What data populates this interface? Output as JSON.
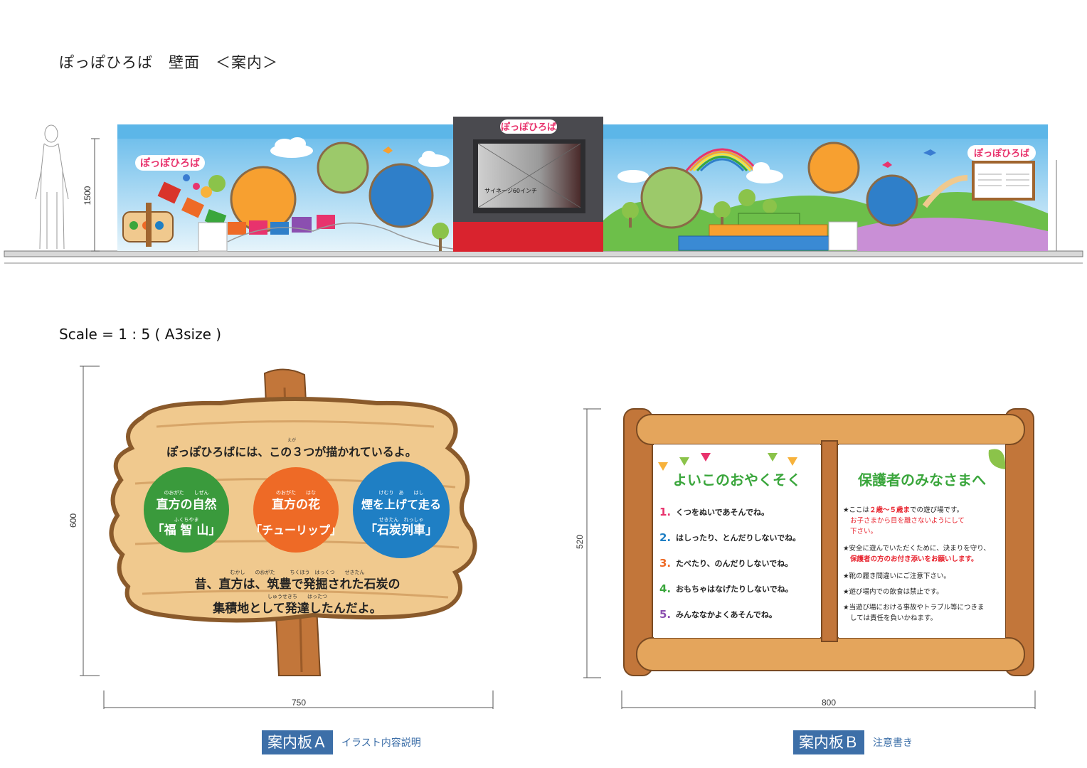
{
  "page_title": "ぽっぽひろば　壁面　＜案内＞",
  "scale": "Scale = 1 : 5 ( A3size )",
  "elevation": {
    "height_dim": "1500",
    "logo_text": "ぽっぽひろば",
    "signage_label": "サイネージ60インチ"
  },
  "signA": {
    "height_dim": "600",
    "width_dim": "750",
    "heading": "ぽっぽひろばには、この３つが描かれているよ。",
    "heading_ruby": "えが",
    "circles": [
      {
        "ruby1": "のおがた　　しぜん",
        "line1": "直方の自然",
        "ruby2": "ふくちやま",
        "line2": "「福 智 山」",
        "color": "#3a9a3c"
      },
      {
        "ruby1": "のおがた　　はな",
        "line1": "直方の花",
        "ruby2": "",
        "line2": "「チューリップ」",
        "color": "#ee6a26"
      },
      {
        "ruby1": "けむり　あ　　はし",
        "line1": "煙を上げて走る",
        "ruby2": "せきたん　れっしゃ",
        "line2": "「石炭列車」",
        "color": "#1f7fc4"
      }
    ],
    "bottom_ruby1": "むかし　　のおがた　　　ちくほう　はっくつ　　せきたん",
    "bottom_line1": "昔、直方は、筑豊で発掘された石炭の",
    "bottom_ruby2": "しゅうせきち　　はったつ",
    "bottom_line2": "集積地として発達したんだよ。",
    "caption": "案内板Ａ",
    "caption_sub": "イラスト内容説明"
  },
  "signB": {
    "height_dim": "520",
    "width_dim": "800",
    "left_title": "よいこのおやくそく",
    "rules": [
      {
        "num": "1.",
        "text": "くつをぬいであそんでね。",
        "color": "#e8336d"
      },
      {
        "num": "2.",
        "text": "はしったり、とんだりしないでね。",
        "color": "#1f7fc4"
      },
      {
        "num": "3.",
        "text": "たべたり、のんだりしないでね。",
        "color": "#ee6a26"
      },
      {
        "num": "4.",
        "text": "おもちゃはなげたりしないでね。",
        "color": "#3aa63c"
      },
      {
        "num": "5.",
        "text": "みんななかよくあそんでね。",
        "color": "#8b4fb0"
      }
    ],
    "right_title": "保護者のみなさまへ",
    "notes": [
      {
        "prefix": "★ここは",
        "highlight": "２歳〜５歳ま",
        "suffix": "での遊び場です。"
      },
      {
        "prefix": "",
        "highlight": "お子さまから目を離さないようにして",
        "suffix": ""
      },
      {
        "prefix": "",
        "highlight": "下さい。",
        "suffix": ""
      },
      {
        "prefix": "★安全に遊んでいただくために、決まりを守り、",
        "highlight": "",
        "suffix": ""
      },
      {
        "prefix": "",
        "highlight": "保護者の方のお付き添いをお願いします。",
        "suffix": ""
      },
      {
        "prefix": "★靴の履き間違いにご注意下さい。",
        "highlight": "",
        "suffix": ""
      },
      {
        "prefix": "★遊び場内での飲食は禁止です。",
        "highlight": "",
        "suffix": ""
      },
      {
        "prefix": "★当遊び場における事故やトラブル等につきま",
        "highlight": "",
        "suffix": ""
      },
      {
        "prefix": "しては責任を負いかねます。",
        "highlight": "",
        "suffix": ""
      }
    ],
    "caption": "案内板Ｂ",
    "caption_sub": "注意書き"
  }
}
